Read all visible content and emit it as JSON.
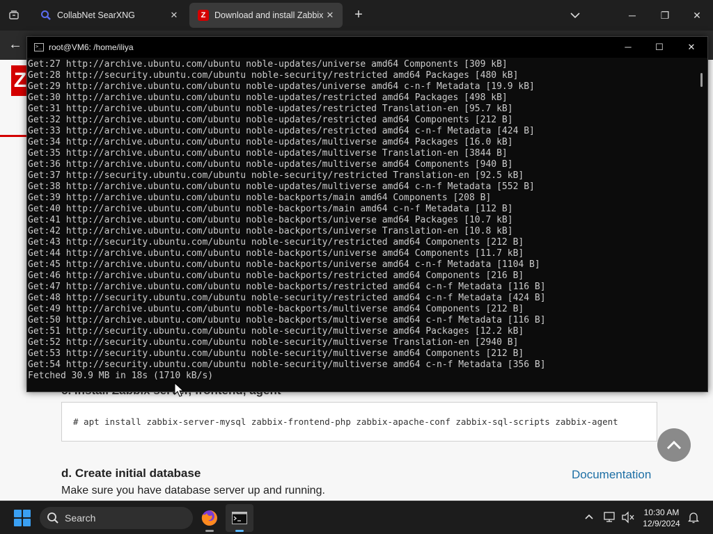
{
  "browser": {
    "tabs": [
      {
        "title": "CollabNet SearXNG",
        "favicon": "search-icon",
        "active": false
      },
      {
        "title": "Download and install Zabbix for",
        "favicon": "Z",
        "active": true
      }
    ],
    "new_tab": "+",
    "colors": {
      "tabbar": "#1f1f1f",
      "active_tab": "#3a3a3a",
      "zabbix_red": "#d40000"
    }
  },
  "page": {
    "logo_letter": "Z",
    "section_partial": "c. Install Zabbix server, frontend, agent",
    "command": "# apt install zabbix-server-mysql zabbix-frontend-php zabbix-apache-conf zabbix-sql-scripts zabbix-agent",
    "heading": "d. Create initial database",
    "doc_link": "Documentation",
    "paragraph": "Make sure you have database server up and running."
  },
  "terminal": {
    "title": "root@VM6: /home/iliya",
    "lines": [
      "Get:27 http://archive.ubuntu.com/ubuntu noble-updates/universe amd64 Components [309 kB]",
      "Get:28 http://security.ubuntu.com/ubuntu noble-security/restricted amd64 Packages [480 kB]",
      "Get:29 http://archive.ubuntu.com/ubuntu noble-updates/universe amd64 c-n-f Metadata [19.9 kB]",
      "Get:30 http://archive.ubuntu.com/ubuntu noble-updates/restricted amd64 Packages [498 kB]",
      "Get:31 http://archive.ubuntu.com/ubuntu noble-updates/restricted Translation-en [95.7 kB]",
      "Get:32 http://archive.ubuntu.com/ubuntu noble-updates/restricted amd64 Components [212 B]",
      "Get:33 http://archive.ubuntu.com/ubuntu noble-updates/restricted amd64 c-n-f Metadata [424 B]",
      "Get:34 http://archive.ubuntu.com/ubuntu noble-updates/multiverse amd64 Packages [16.0 kB]",
      "Get:35 http://archive.ubuntu.com/ubuntu noble-updates/multiverse Translation-en [3844 B]",
      "Get:36 http://archive.ubuntu.com/ubuntu noble-updates/multiverse amd64 Components [940 B]",
      "Get:37 http://security.ubuntu.com/ubuntu noble-security/restricted Translation-en [92.5 kB]",
      "Get:38 http://archive.ubuntu.com/ubuntu noble-updates/multiverse amd64 c-n-f Metadata [552 B]",
      "Get:39 http://archive.ubuntu.com/ubuntu noble-backports/main amd64 Components [208 B]",
      "Get:40 http://archive.ubuntu.com/ubuntu noble-backports/main amd64 c-n-f Metadata [112 B]",
      "Get:41 http://archive.ubuntu.com/ubuntu noble-backports/universe amd64 Packages [10.7 kB]",
      "Get:42 http://archive.ubuntu.com/ubuntu noble-backports/universe Translation-en [10.8 kB]",
      "Get:43 http://security.ubuntu.com/ubuntu noble-security/restricted amd64 Components [212 B]",
      "Get:44 http://archive.ubuntu.com/ubuntu noble-backports/universe amd64 Components [11.7 kB]",
      "Get:45 http://archive.ubuntu.com/ubuntu noble-backports/universe amd64 c-n-f Metadata [1104 B]",
      "Get:46 http://archive.ubuntu.com/ubuntu noble-backports/restricted amd64 Components [216 B]",
      "Get:47 http://archive.ubuntu.com/ubuntu noble-backports/restricted amd64 c-n-f Metadata [116 B]",
      "Get:48 http://security.ubuntu.com/ubuntu noble-security/restricted amd64 c-n-f Metadata [424 B]",
      "Get:49 http://archive.ubuntu.com/ubuntu noble-backports/multiverse amd64 Components [212 B]",
      "Get:50 http://archive.ubuntu.com/ubuntu noble-backports/multiverse amd64 c-n-f Metadata [116 B]",
      "Get:51 http://security.ubuntu.com/ubuntu noble-security/multiverse amd64 Packages [12.2 kB]",
      "Get:52 http://security.ubuntu.com/ubuntu noble-security/multiverse Translation-en [2940 B]",
      "Get:53 http://security.ubuntu.com/ubuntu noble-security/multiverse amd64 Components [212 B]",
      "Get:54 http://security.ubuntu.com/ubuntu noble-security/multiverse amd64 c-n-f Metadata [356 B]",
      "Fetched 30.9 MB in 18s (1710 kB/s)"
    ]
  },
  "taskbar": {
    "search_label": "Search",
    "time": "10:30 AM",
    "date": "12/9/2024",
    "accent": "#5cb8ff"
  }
}
